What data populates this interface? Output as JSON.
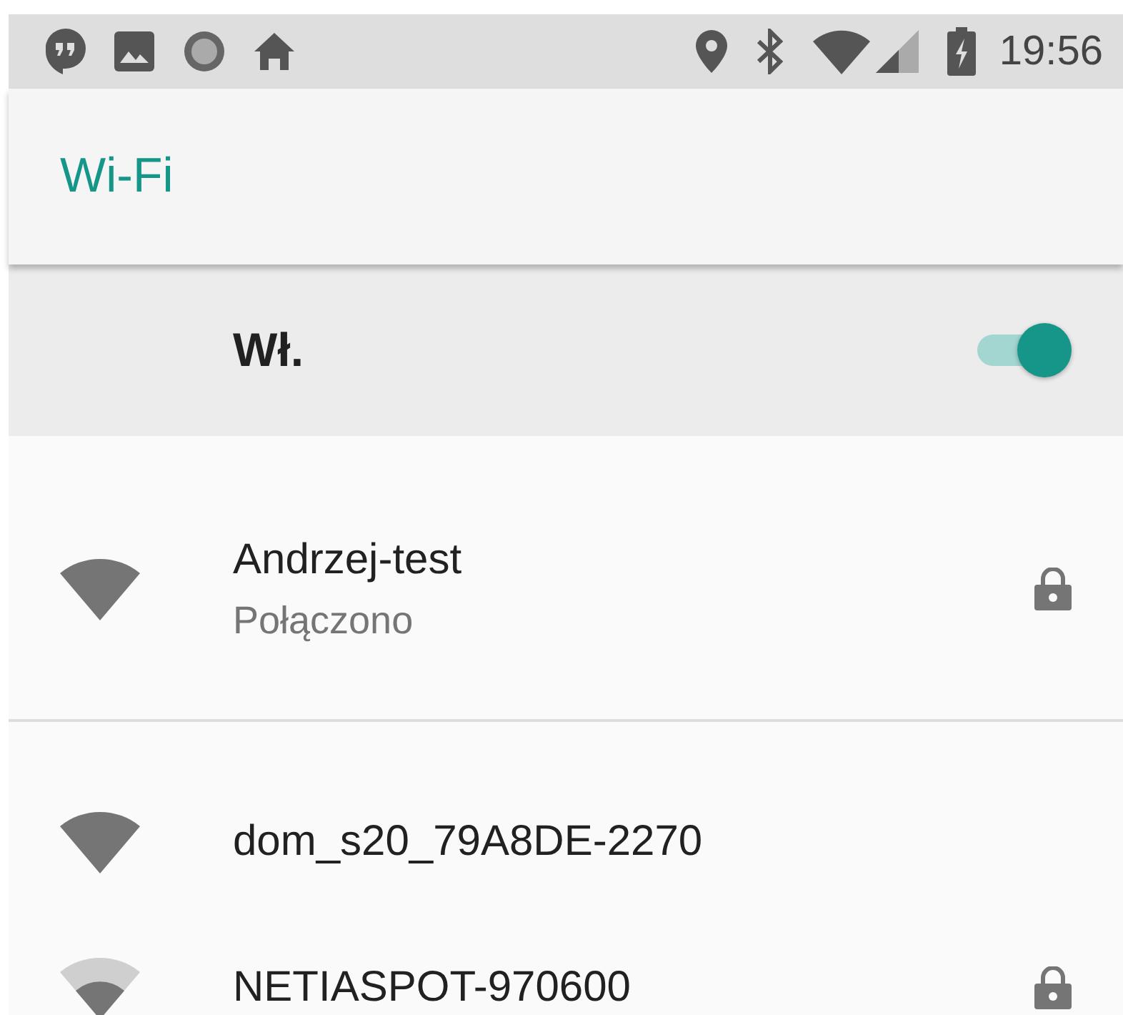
{
  "status_bar": {
    "time": "19:56"
  },
  "app_bar": {
    "title": "Wi-Fi"
  },
  "master_switch": {
    "label": "Wł.",
    "on": true
  },
  "networks": [
    {
      "name": "Andrzej-test",
      "status": "Połączono",
      "secured": true,
      "kind": "strong"
    },
    {
      "name": "dom_s20_79A8DE-2270",
      "secured": false,
      "kind": "strong"
    },
    {
      "name": "NETIASPOT-970600",
      "secured": true,
      "kind": "weak"
    }
  ]
}
